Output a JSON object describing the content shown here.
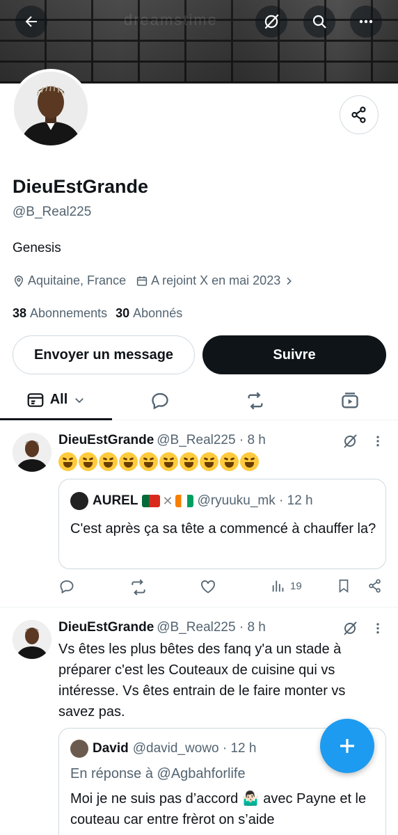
{
  "banner": {
    "watermark": "dreamstime"
  },
  "profile": {
    "display_name": "DieuEstGrande",
    "handle": "@B_Real225",
    "bio": "Genesis",
    "location": "Aquitaine, France",
    "joined": "A rejoint X en mai 2023",
    "following_count": "38",
    "following_label": "Abonnements",
    "followers_count": "30",
    "followers_label": "Abonnés",
    "message_button": "Envoyer un message",
    "follow_button": "Suivre"
  },
  "tabs": {
    "all_label": "All"
  },
  "tweets": [
    {
      "name": "DieuEstGrande",
      "handle_time": "@B_Real225 · 8 h",
      "quote": {
        "name": "AUREL",
        "handle_time": "@ryuuku_mk · 12 h",
        "text": "C'est après ça sa tête a commencé à chauffer la?"
      },
      "views": "19"
    },
    {
      "name": "DieuEstGrande",
      "handle_time": "@B_Real225 · 8 h",
      "text": "Vs êtes les plus bêtes des fanq y'a un stade à préparer c'est les Couteaux de cuisine qui vs intéresse. Vs êtes entrain de le faire monter vs savez pas.",
      "quote": {
        "name": "David",
        "handle_time": "@david_wowo · 12 h",
        "reply_to": "En réponse à @Agbahforlife",
        "text": "Moi je ne suis pas d’accord 🤷🏻‍♂️ avec Payne et le couteau car entre frèrot on s’aide"
      }
    }
  ],
  "colors": {
    "accent": "#1d9bf0",
    "text": "#0f1419",
    "muted": "#536471",
    "border": "#cfd9de"
  }
}
